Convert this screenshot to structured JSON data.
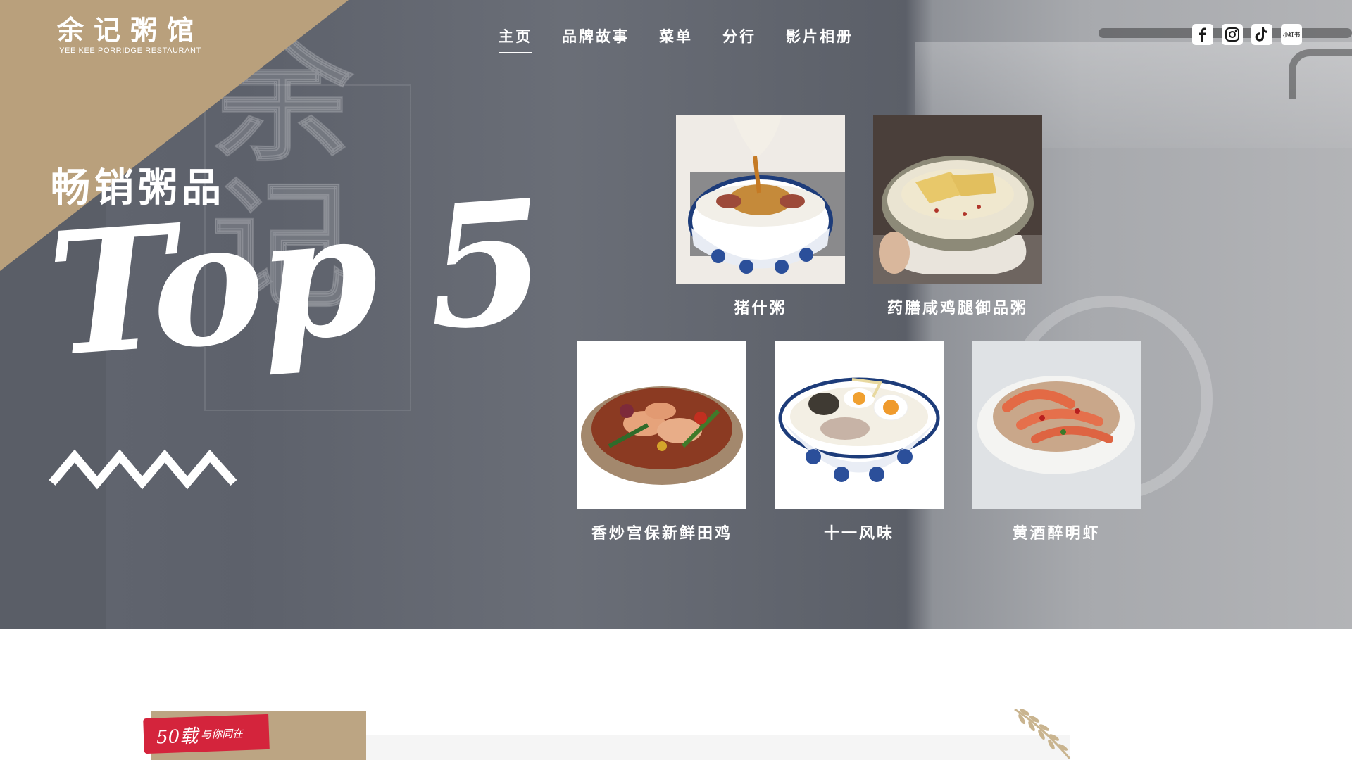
{
  "logo": {
    "cn": "余记粥馆",
    "en": "YEE KEE PORRIDGE RESTAURANT"
  },
  "nav": {
    "items": [
      {
        "label": "主页",
        "active": true
      },
      {
        "label": "品牌故事",
        "active": false
      },
      {
        "label": "菜单",
        "active": false
      },
      {
        "label": "分行",
        "active": false
      },
      {
        "label": "影片相册",
        "active": false
      }
    ]
  },
  "social": {
    "icons": [
      "facebook-icon",
      "instagram-icon",
      "tiktok-icon",
      "xiaohongshu-icon"
    ],
    "xiaohongshu_text": "小红书"
  },
  "hero": {
    "subtitle": "畅销粥品",
    "headline": "Top 5",
    "dishes": [
      {
        "name": "猪什粥"
      },
      {
        "name": "药膳咸鸡腿御品粥"
      },
      {
        "name": "香炒宫保新鲜田鸡"
      },
      {
        "name": "十一风味"
      },
      {
        "name": "黄酒醉明虾"
      }
    ]
  },
  "lower": {
    "badge_number": "50载",
    "badge_text": "与你同在"
  },
  "colors": {
    "gold": "#b9a07c",
    "badge_red": "#d4243c",
    "hero_grey": "#626670"
  }
}
